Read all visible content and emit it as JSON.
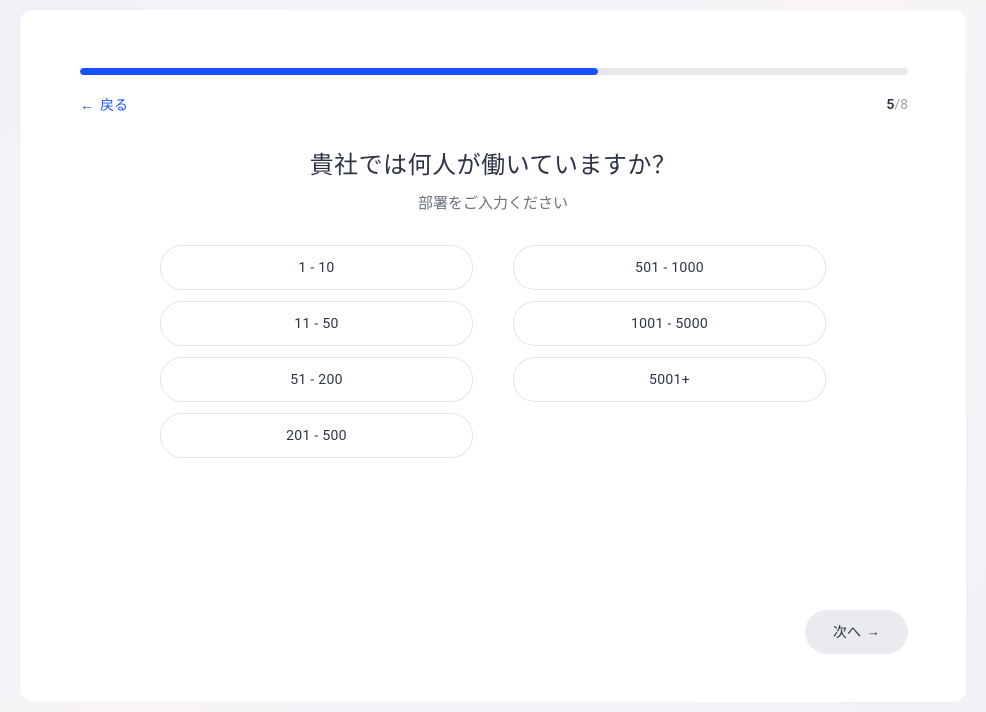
{
  "progress": {
    "percent": 62.5,
    "current": "5",
    "total": "8",
    "separator": "/"
  },
  "back": {
    "label": "戻る"
  },
  "question": {
    "title": "貴社では何人が働いていますか？",
    "subtitle": "部署をご入力ください"
  },
  "options": {
    "left": [
      "1 - 10",
      "11 - 50",
      "51 - 200",
      "201 - 500"
    ],
    "right": [
      "501 - 1000",
      "1001 - 5000",
      "5001+"
    ]
  },
  "next": {
    "label": "次へ"
  }
}
